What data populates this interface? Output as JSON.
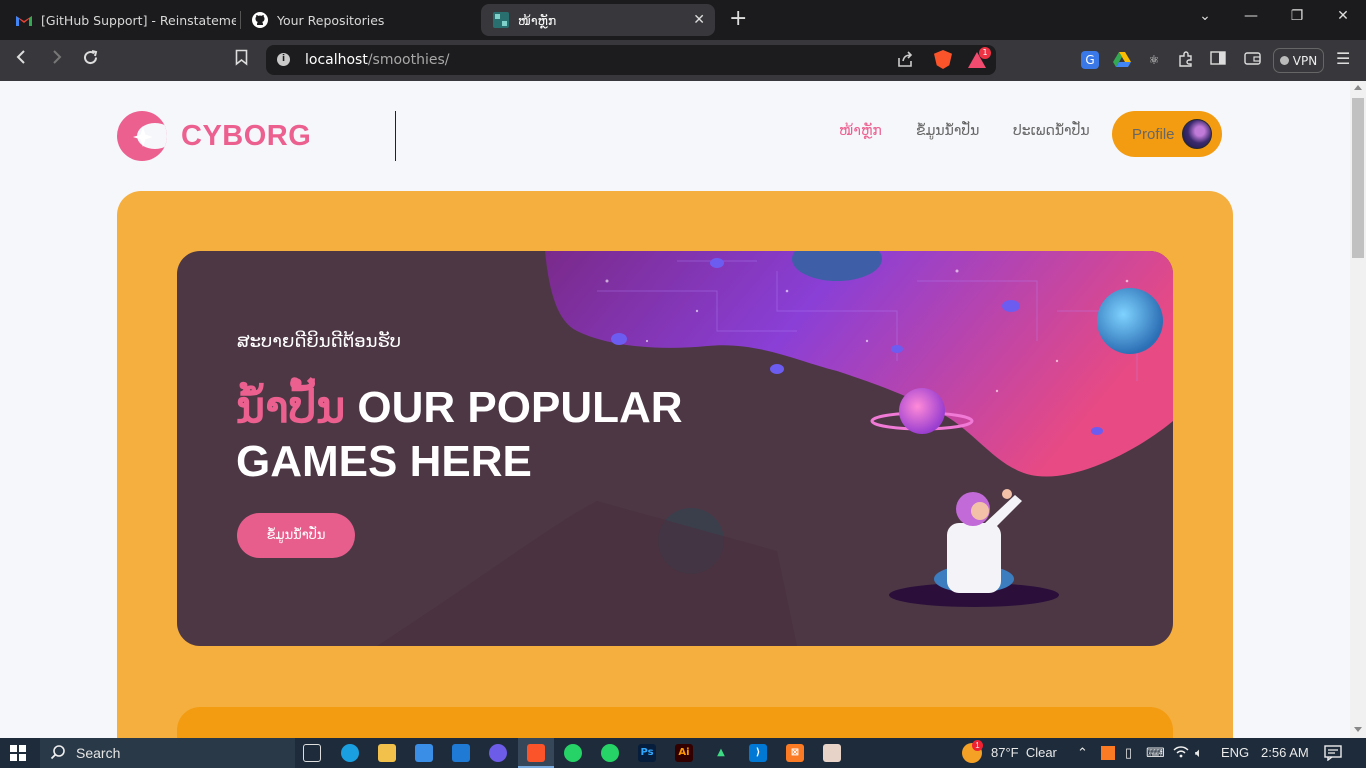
{
  "browser": {
    "tabs": [
      {
        "title": "[GitHub Support] - Reinstatement Re",
        "icon": "gmail-icon"
      },
      {
        "title": "Your Repositories",
        "icon": "github-icon"
      },
      {
        "title": "ໜ້າຫຼັກ",
        "icon": "site-favicon",
        "active": true
      }
    ],
    "url_host": "localhost",
    "url_path": "/smoothies/",
    "vpn_label": "VPN",
    "rewards_badge": "1"
  },
  "site": {
    "logo_text": "CYBORG",
    "nav": [
      {
        "label": "ໜ້າຫຼັກ",
        "active": true
      },
      {
        "label": "ຂໍ້ມູນນໍ້າປັ່ນ",
        "active": false
      },
      {
        "label": "ປະເພດນໍ້າປັ່ນ",
        "active": false
      }
    ],
    "profile_label": "Profile",
    "banner": {
      "welcome": "ສະບາຍດີຍິນດີຕ້ອນຮັບ",
      "headline_accent": "ນໍ້າປັ້ນ",
      "headline_rest": " OUR POPULAR GAMES HERE",
      "cta_label": "ຂໍ້ມູນນໍ້າປັ່ນ"
    },
    "colors": {
      "accent": "#ec6090",
      "orange": "#f5af3f",
      "banner": "#4d3745"
    }
  },
  "taskbar": {
    "search_label": "Search",
    "weather": "87°F  Clear",
    "weather_badge": "1",
    "lang": "ENG",
    "time": "2:56 AM"
  }
}
